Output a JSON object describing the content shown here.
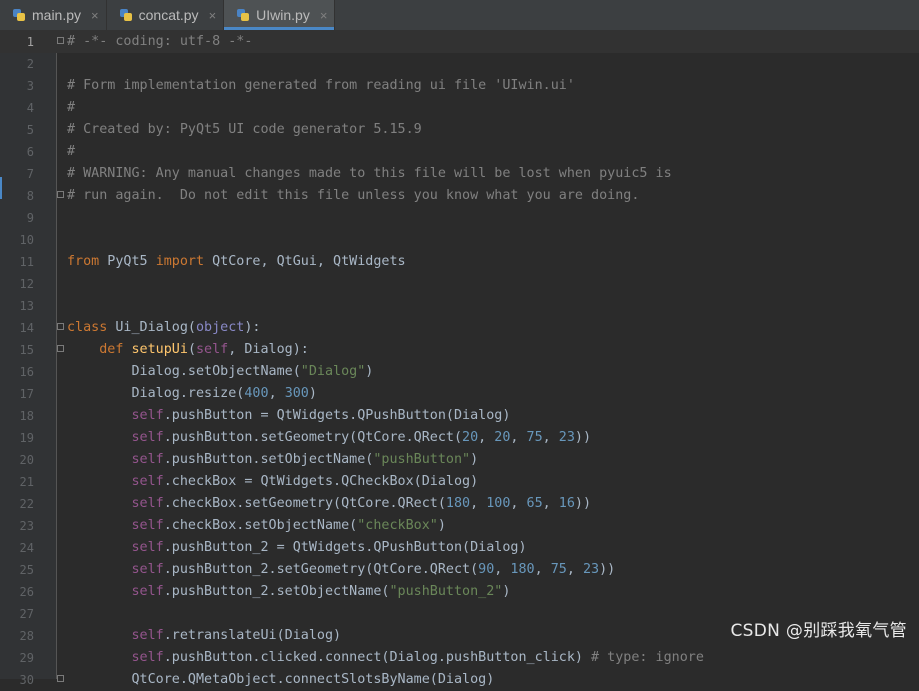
{
  "tabs": [
    {
      "label": "main.py",
      "close": "×",
      "active": false
    },
    {
      "label": "concat.py",
      "close": "×",
      "active": false
    },
    {
      "label": "UIwin.py",
      "close": "×",
      "active": true
    }
  ],
  "icons": {
    "file_type": "python-file-icon",
    "tab_close": "close-icon",
    "fold": "fold-marker-icon"
  },
  "colors": {
    "background": "#2b2b2b",
    "gutter": "#313335",
    "tab_active_underline": "#4a88c7",
    "keyword": "#cc7832",
    "comment": "#808080",
    "string": "#6a8759",
    "number": "#6897bb",
    "self": "#94558d",
    "function_def": "#ffc66d",
    "builtin": "#8888c6",
    "default": "#a9b7c6"
  },
  "editor": {
    "current_line": 1,
    "lines": [
      {
        "n": "1",
        "tokens": [
          [
            "cm",
            "# -*- coding: utf-8 -*-"
          ]
        ]
      },
      {
        "n": "2",
        "tokens": []
      },
      {
        "n": "3",
        "tokens": [
          [
            "cm",
            "# Form implementation generated from reading ui file 'UIwin.ui'"
          ]
        ]
      },
      {
        "n": "4",
        "tokens": [
          [
            "cm",
            "#"
          ]
        ]
      },
      {
        "n": "5",
        "tokens": [
          [
            "cm",
            "# Created by: PyQt5 UI code generator 5.15.9"
          ]
        ]
      },
      {
        "n": "6",
        "tokens": [
          [
            "cm",
            "#"
          ]
        ]
      },
      {
        "n": "7",
        "tokens": [
          [
            "cm",
            "# WARNING: Any manual changes made to this file will be lost when pyuic5 is"
          ]
        ]
      },
      {
        "n": "8",
        "tokens": [
          [
            "cm",
            "# run again.  Do not edit this file unless you know what you are doing."
          ]
        ]
      },
      {
        "n": "9",
        "tokens": []
      },
      {
        "n": "10",
        "tokens": []
      },
      {
        "n": "11",
        "tokens": [
          [
            "kw",
            "from"
          ],
          [
            "",
            " PyQt5 "
          ],
          [
            "kw",
            "import"
          ],
          [
            "",
            " QtCore, QtGui, QtWidgets"
          ]
        ]
      },
      {
        "n": "12",
        "tokens": []
      },
      {
        "n": "13",
        "tokens": []
      },
      {
        "n": "14",
        "tokens": [
          [
            "kw",
            "class"
          ],
          [
            "",
            " Ui_Dialog("
          ],
          [
            "bi",
            "object"
          ],
          [
            "",
            "):"
          ]
        ]
      },
      {
        "n": "15",
        "tokens": [
          [
            "",
            "    "
          ],
          [
            "kw",
            "def"
          ],
          [
            "",
            " "
          ],
          [
            "fn",
            "setupUi"
          ],
          [
            "",
            "("
          ],
          [
            "sf",
            "self"
          ],
          [
            "",
            ", Dialog):"
          ]
        ]
      },
      {
        "n": "16",
        "tokens": [
          [
            "",
            "        Dialog.setObjectName("
          ],
          [
            "st",
            "\"Dialog\""
          ],
          [
            "",
            ")"
          ]
        ]
      },
      {
        "n": "17",
        "tokens": [
          [
            "",
            "        Dialog.resize("
          ],
          [
            "nu",
            "400"
          ],
          [
            "",
            ", "
          ],
          [
            "nu",
            "300"
          ],
          [
            "",
            ")"
          ]
        ]
      },
      {
        "n": "18",
        "tokens": [
          [
            "",
            "        "
          ],
          [
            "sf",
            "self"
          ],
          [
            "",
            ".pushButton = QtWidgets.QPushButton(Dialog)"
          ]
        ]
      },
      {
        "n": "19",
        "tokens": [
          [
            "",
            "        "
          ],
          [
            "sf",
            "self"
          ],
          [
            "",
            ".pushButton.setGeometry(QtCore.QRect("
          ],
          [
            "nu",
            "20"
          ],
          [
            "",
            ", "
          ],
          [
            "nu",
            "20"
          ],
          [
            "",
            ", "
          ],
          [
            "nu",
            "75"
          ],
          [
            "",
            ", "
          ],
          [
            "nu",
            "23"
          ],
          [
            "",
            "))"
          ]
        ]
      },
      {
        "n": "20",
        "tokens": [
          [
            "",
            "        "
          ],
          [
            "sf",
            "self"
          ],
          [
            "",
            ".pushButton.setObjectName("
          ],
          [
            "st",
            "\"pushButton\""
          ],
          [
            "",
            ")"
          ]
        ]
      },
      {
        "n": "21",
        "tokens": [
          [
            "",
            "        "
          ],
          [
            "sf",
            "self"
          ],
          [
            "",
            ".checkBox = QtWidgets.QCheckBox(Dialog)"
          ]
        ]
      },
      {
        "n": "22",
        "tokens": [
          [
            "",
            "        "
          ],
          [
            "sf",
            "self"
          ],
          [
            "",
            ".checkBox.setGeometry(QtCore.QRect("
          ],
          [
            "nu",
            "180"
          ],
          [
            "",
            ", "
          ],
          [
            "nu",
            "100"
          ],
          [
            "",
            ", "
          ],
          [
            "nu",
            "65"
          ],
          [
            "",
            ", "
          ],
          [
            "nu",
            "16"
          ],
          [
            "",
            "))"
          ]
        ]
      },
      {
        "n": "23",
        "tokens": [
          [
            "",
            "        "
          ],
          [
            "sf",
            "self"
          ],
          [
            "",
            ".checkBox.setObjectName("
          ],
          [
            "st",
            "\"checkBox\""
          ],
          [
            "",
            ")"
          ]
        ]
      },
      {
        "n": "24",
        "tokens": [
          [
            "",
            "        "
          ],
          [
            "sf",
            "self"
          ],
          [
            "",
            ".pushButton_2 = QtWidgets.QPushButton(Dialog)"
          ]
        ]
      },
      {
        "n": "25",
        "tokens": [
          [
            "",
            "        "
          ],
          [
            "sf",
            "self"
          ],
          [
            "",
            ".pushButton_2.setGeometry(QtCore.QRect("
          ],
          [
            "nu",
            "90"
          ],
          [
            "",
            ", "
          ],
          [
            "nu",
            "180"
          ],
          [
            "",
            ", "
          ],
          [
            "nu",
            "75"
          ],
          [
            "",
            ", "
          ],
          [
            "nu",
            "23"
          ],
          [
            "",
            "))"
          ]
        ]
      },
      {
        "n": "26",
        "tokens": [
          [
            "",
            "        "
          ],
          [
            "sf",
            "self"
          ],
          [
            "",
            ".pushButton_2.setObjectName("
          ],
          [
            "st",
            "\"pushButton_2\""
          ],
          [
            "",
            ")"
          ]
        ]
      },
      {
        "n": "27",
        "tokens": []
      },
      {
        "n": "28",
        "tokens": [
          [
            "",
            "        "
          ],
          [
            "sf",
            "self"
          ],
          [
            "",
            ".retranslateUi(Dialog)"
          ]
        ]
      },
      {
        "n": "29",
        "tokens": [
          [
            "",
            "        "
          ],
          [
            "sf",
            "self"
          ],
          [
            "",
            ".pushButton.clicked.connect(Dialog.pushButton_click) "
          ],
          [
            "cm",
            "# type: ignore"
          ]
        ]
      },
      {
        "n": "30",
        "tokens": [
          [
            "",
            "        QtCore.QMetaObject.connectSlotsByName(Dialog)"
          ]
        ]
      }
    ],
    "fold_lines": [
      1,
      8,
      14,
      15,
      30
    ]
  },
  "watermark": "CSDN @别踩我氧气管"
}
